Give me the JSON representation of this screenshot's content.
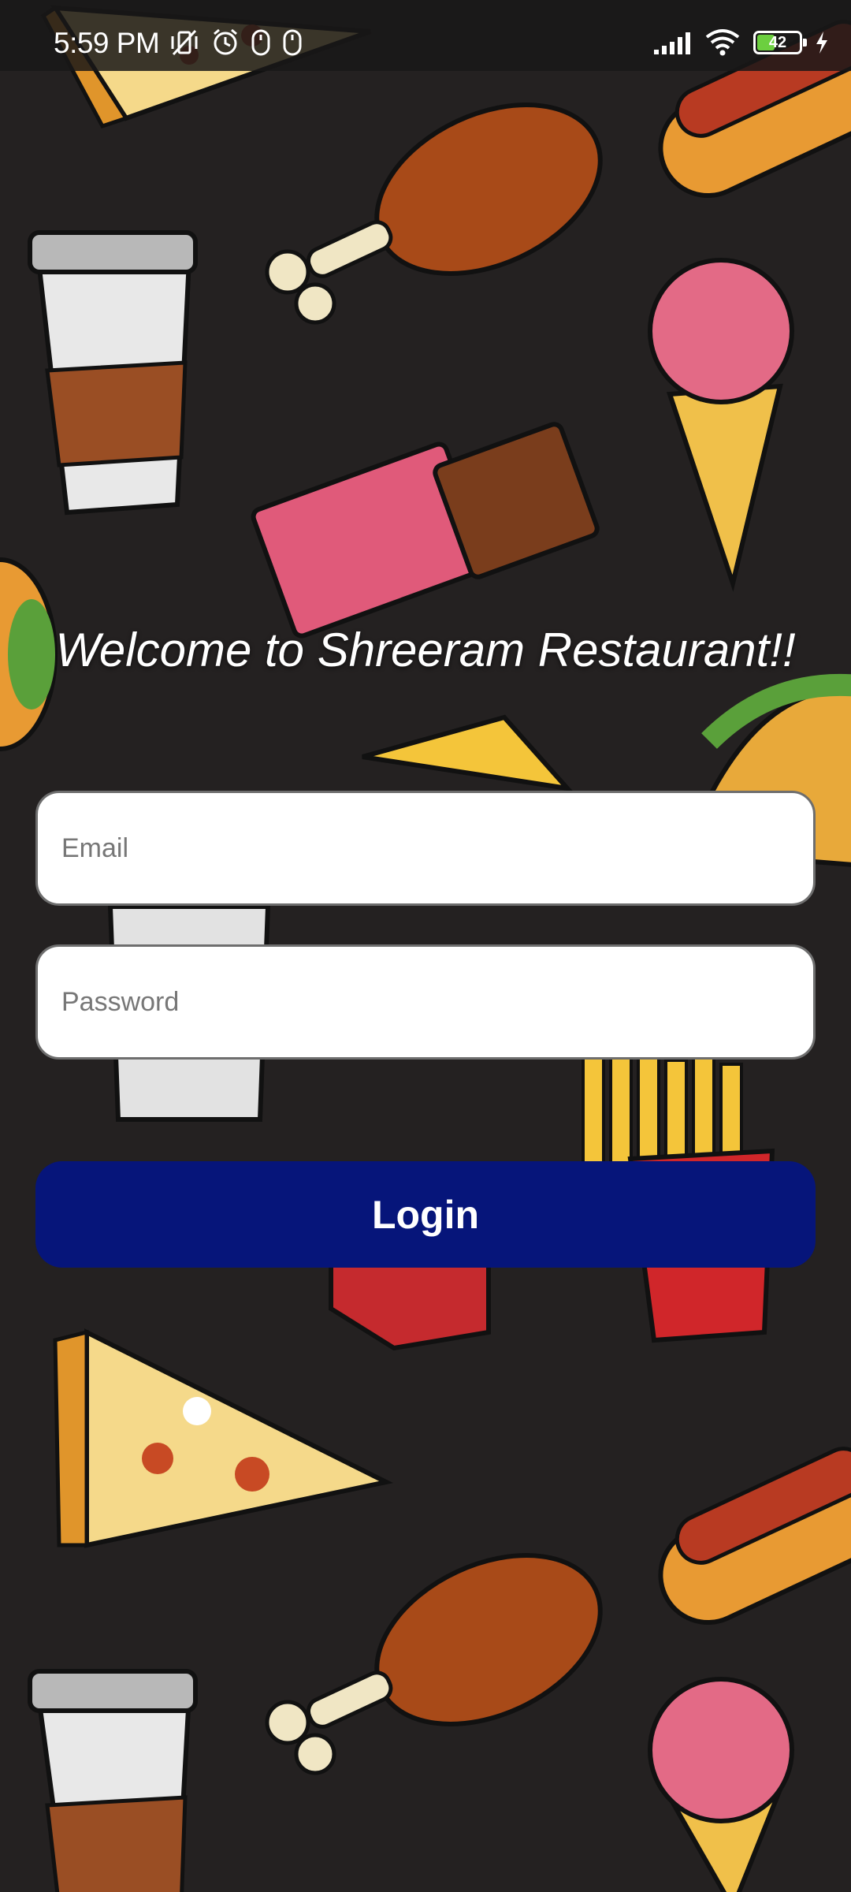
{
  "status_bar": {
    "time": "5:59 PM",
    "battery_level": 42,
    "battery_text": "42",
    "left_icons": [
      "vibrate-off-icon",
      "alarm-icon",
      "mouse-icon",
      "mouse-icon"
    ],
    "right_icons": [
      "signal-icon",
      "wifi-icon",
      "battery-icon",
      "charging-icon"
    ]
  },
  "welcome_title": "Welcome to Shreeram Restaurant!!",
  "form": {
    "email_placeholder": "Email",
    "email_value": "",
    "password_placeholder": "Password",
    "password_value": "",
    "login_label": "Login"
  },
  "background": {
    "description_icon": "food-doodle-pattern",
    "color": "#242121"
  },
  "colors": {
    "button": "#06157a",
    "battery_fill": "#6ccf3f"
  }
}
